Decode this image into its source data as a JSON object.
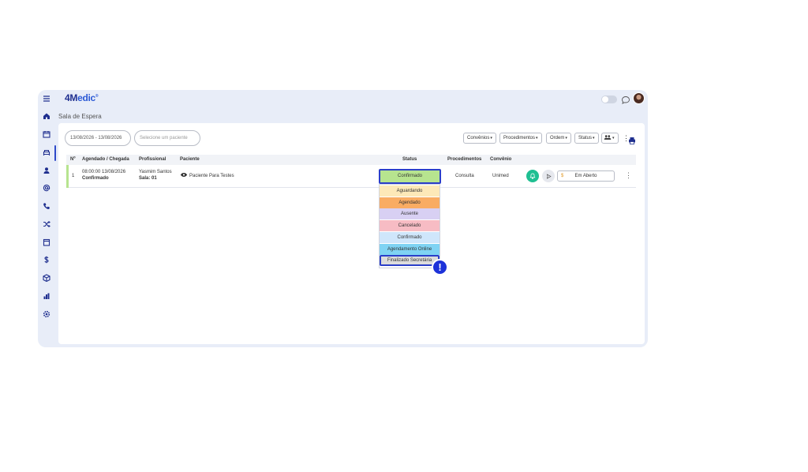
{
  "app": {
    "logo_bold": "4M",
    "logo_rest": "edic",
    "logo_mark": "®",
    "breadcrumb": "Sala de Espera"
  },
  "sidebar": {
    "icons": [
      "menu-icon",
      "home-icon",
      "calendar-icon",
      "sofa-icon",
      "user-icon",
      "at-icon",
      "phone-icon",
      "shuffle-icon",
      "clipboard-icon",
      "dollar-icon",
      "box-icon",
      "chart-icon",
      "settings-icon"
    ],
    "active_index": 3
  },
  "filters": {
    "date_range": "13/08/2026 - 13/08/2026",
    "patient_placeholder": "Selecione um paciente",
    "convenios": "Convênios",
    "procedimentos": "Procedimentos",
    "ordem": "Ordem",
    "status": "Status",
    "caret": "▾"
  },
  "table": {
    "headers": {
      "num": "Nº",
      "agendado": "Agendado / Chegada",
      "profissional": "Profissional",
      "paciente": "Paciente",
      "status": "Status",
      "procedimentos": "Procedimentos",
      "convenio": "Convênio"
    },
    "rows": [
      {
        "num": "1",
        "datetime": "08:00:00 13/08/2026",
        "state": "Confirmado",
        "professional": "Yasmim Santos",
        "room": "Sala: 01",
        "patient": "Paciente Para Testes",
        "status": "Confirmado",
        "procedure": "Consulta",
        "insurance": "Unimed",
        "payment_symbol": "$",
        "payment": "Em Aberto"
      }
    ]
  },
  "status_dropdown": {
    "options": [
      {
        "label": "Aguardando",
        "color": "#fde9b8"
      },
      {
        "label": "Agendado",
        "color": "#f9ac63"
      },
      {
        "label": "Ausente",
        "color": "#d8d0f3"
      },
      {
        "label": "Cancelado",
        "color": "#f7bcc4"
      },
      {
        "label": "Confirmado",
        "color": "#cfe6fb"
      },
      {
        "label": "Agendamento Online",
        "color": "#7fd3f3"
      },
      {
        "label": "Finalizado Secretária",
        "color": "#dcdcdc"
      }
    ],
    "selected_index": 6
  },
  "indicator": "!",
  "colors": {
    "accent": "#2b3fc9",
    "confirmed": "#b7e48f",
    "bell": "#1fbf92"
  }
}
